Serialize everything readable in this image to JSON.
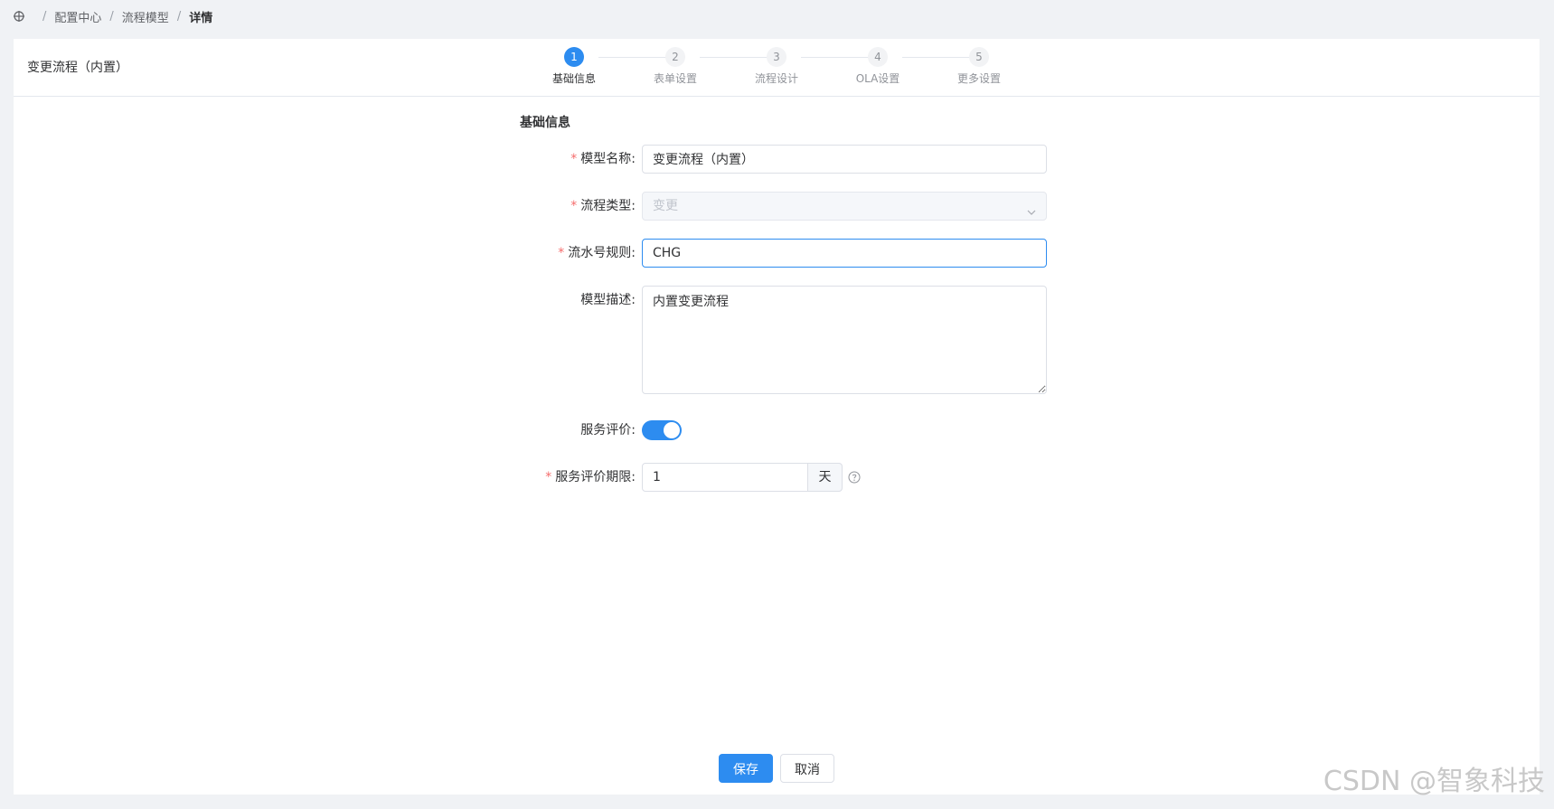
{
  "breadcrumb": {
    "items": [
      "配置中心",
      "流程模型"
    ],
    "current": "详情",
    "separator": "/"
  },
  "panel": {
    "title": "变更流程（内置）"
  },
  "steps": [
    {
      "number": "1",
      "label": "基础信息",
      "active": true
    },
    {
      "number": "2",
      "label": "表单设置",
      "active": false
    },
    {
      "number": "3",
      "label": "流程设计",
      "active": false
    },
    {
      "number": "4",
      "label": "OLA设置",
      "active": false
    },
    {
      "number": "5",
      "label": "更多设置",
      "active": false
    }
  ],
  "form": {
    "section_title": "基础信息",
    "model_name": {
      "label": "模型名称:",
      "value": "变更流程（内置）",
      "required": true
    },
    "flow_type": {
      "label": "流程类型:",
      "value": "变更",
      "required": true,
      "disabled": true
    },
    "serial_rule": {
      "label": "流水号规则:",
      "value": "CHG",
      "required": true
    },
    "description": {
      "label": "模型描述:",
      "value": "内置变更流程",
      "required": false
    },
    "service_rating": {
      "label": "服务评价:",
      "enabled": true
    },
    "rating_period": {
      "label": "服务评价期限:",
      "value": "1",
      "unit": "天",
      "required": true
    }
  },
  "actions": {
    "save": "保存",
    "cancel": "取消"
  },
  "watermark": "CSDN @智象科技",
  "colors": {
    "primary": "#2d8cf0",
    "required": "#f56c6c"
  },
  "icons": {
    "home": "crosshair-home-icon",
    "select": "chevron-down-icon",
    "help": "question-circle-icon"
  }
}
